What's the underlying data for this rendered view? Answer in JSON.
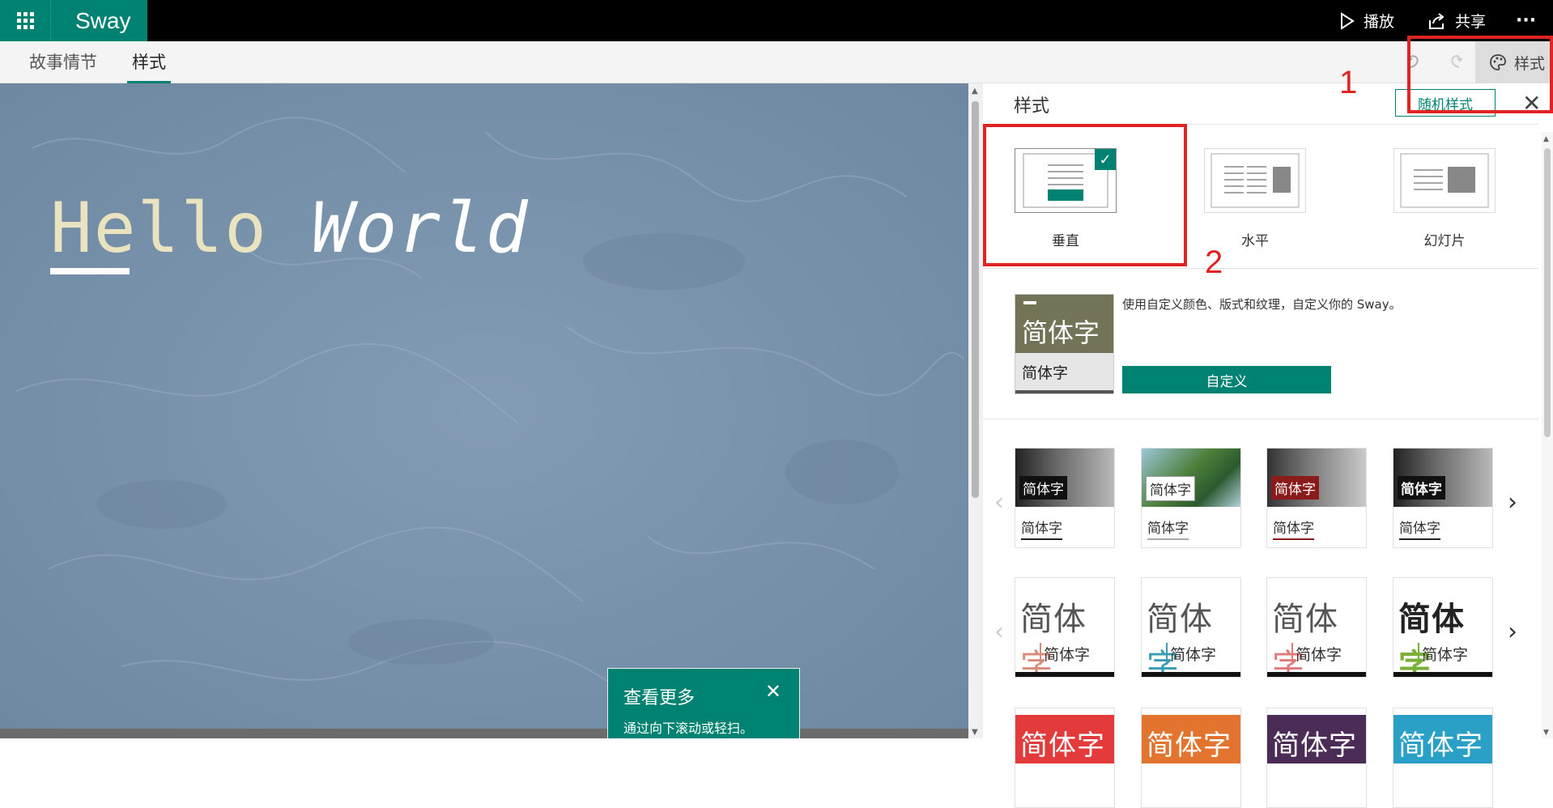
{
  "app": {
    "name": "Sway"
  },
  "topbar": {
    "play_label": "播放",
    "share_label": "共享",
    "more_label": "···"
  },
  "tabs": [
    {
      "label": "故事情节"
    },
    {
      "label": "样式"
    }
  ],
  "toolbar": {
    "style_button_label": "样式"
  },
  "canvas": {
    "title_plain": "Hello",
    "title_italic": "World",
    "tip": {
      "title": "查看更多",
      "desc": "通过向下滚动或轻扫。"
    }
  },
  "style_panel": {
    "title": "样式",
    "random_button": "随机样式",
    "layouts": [
      {
        "label": "垂直",
        "selected": true
      },
      {
        "label": "水平",
        "selected": false
      },
      {
        "label": "幻灯片",
        "selected": false
      }
    ],
    "custom": {
      "thumb_big": "简体字",
      "thumb_small": "简体字",
      "description": "使用自定义颜色、版式和纹理，自定义你的 Sway。",
      "button": "自定义"
    },
    "row1": [
      {
        "label": "简体字",
        "sub": "简体字"
      },
      {
        "label": "简体字",
        "sub": "简体字"
      },
      {
        "label": "简体字",
        "sub": "简体字"
      },
      {
        "label": "简体字",
        "sub": "简体字"
      }
    ],
    "row2": [
      {
        "big": "简体",
        "accent": "字",
        "sub": "简体字",
        "accent_color": "#d98b7a"
      },
      {
        "big": "简体",
        "accent": "字",
        "sub": "简体字",
        "accent_color": "#3a9bb5"
      },
      {
        "big": "简体",
        "accent": "字",
        "sub": "简体字",
        "accent_color": "#e07a7a"
      },
      {
        "big": "简体",
        "accent": "字",
        "sub": "简体字",
        "accent_color": "#7ab038"
      }
    ],
    "row3": [
      {
        "big": "简体字",
        "color": "#e33b3b"
      },
      {
        "big": "简体字",
        "color": "#e2742f"
      },
      {
        "big": "简体字",
        "color": "#4a2c56"
      },
      {
        "big": "简体字",
        "color": "#2ba0c6"
      }
    ]
  },
  "annotations": [
    {
      "label": "1"
    },
    {
      "label": "2"
    }
  ],
  "colors": {
    "accent": "#008272",
    "annotation": "#e02424"
  }
}
